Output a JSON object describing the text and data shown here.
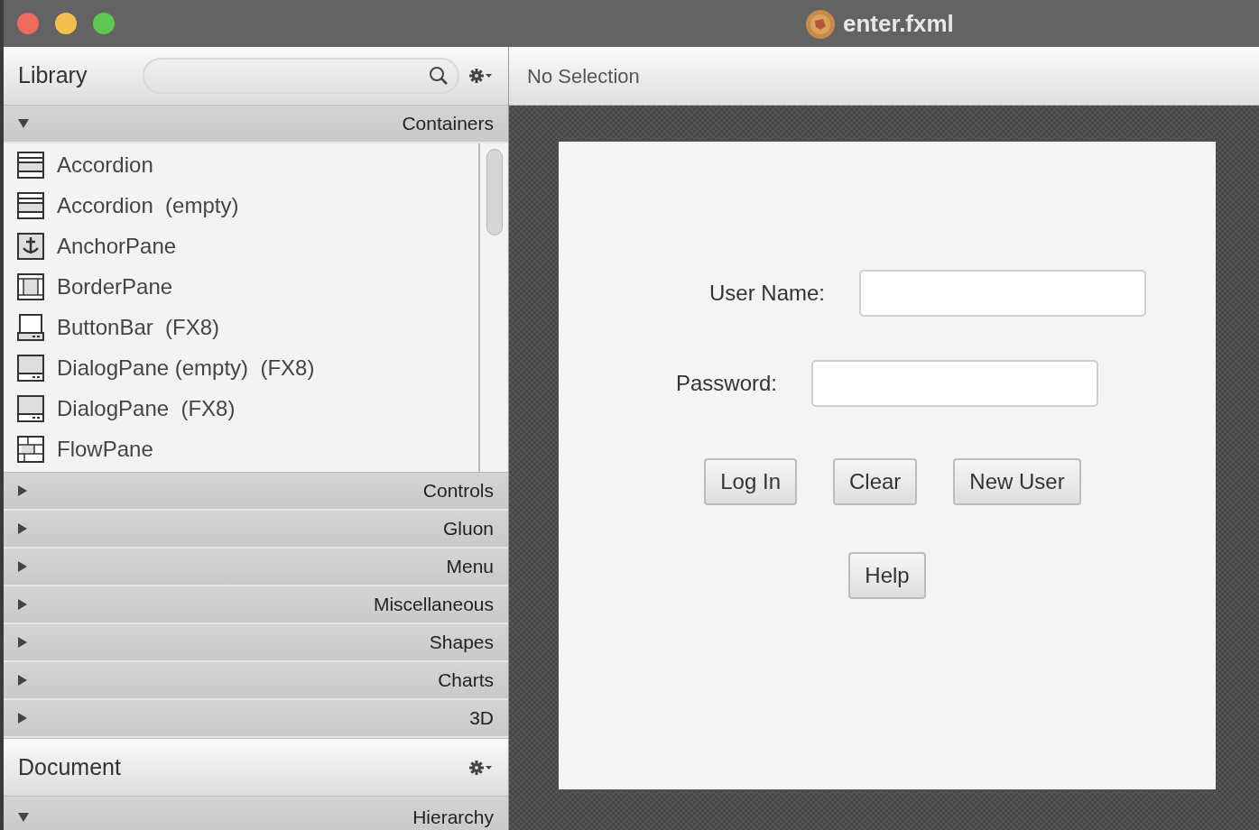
{
  "window": {
    "title": "enter.fxml"
  },
  "library": {
    "title": "Library",
    "sections": [
      {
        "label": "Containers",
        "expanded": true,
        "items": [
          {
            "label": "Accordion",
            "kind": "accordion"
          },
          {
            "label": "Accordion  (empty)",
            "kind": "accordion"
          },
          {
            "label": "AnchorPane",
            "kind": "anchor"
          },
          {
            "label": "BorderPane",
            "kind": "border"
          },
          {
            "label": "ButtonBar  (FX8)",
            "kind": "buttonbar"
          },
          {
            "label": "DialogPane (empty)  (FX8)",
            "kind": "dialog"
          },
          {
            "label": "DialogPane  (FX8)",
            "kind": "dialog"
          },
          {
            "label": "FlowPane",
            "kind": "flow"
          }
        ]
      },
      {
        "label": "Controls",
        "expanded": false
      },
      {
        "label": "Gluon",
        "expanded": false
      },
      {
        "label": "Menu",
        "expanded": false
      },
      {
        "label": "Miscellaneous",
        "expanded": false
      },
      {
        "label": "Shapes",
        "expanded": false
      },
      {
        "label": "Charts",
        "expanded": false
      },
      {
        "label": "3D",
        "expanded": false
      }
    ]
  },
  "document": {
    "title": "Document",
    "sections": [
      {
        "label": "Hierarchy",
        "expanded": true
      }
    ]
  },
  "inspector": {
    "status": "No Selection"
  },
  "form": {
    "fields": [
      {
        "label": "User Name:"
      },
      {
        "label": "Password:"
      }
    ],
    "buttons": [
      "Log In",
      "Clear",
      "New User"
    ],
    "help_button": "Help"
  }
}
